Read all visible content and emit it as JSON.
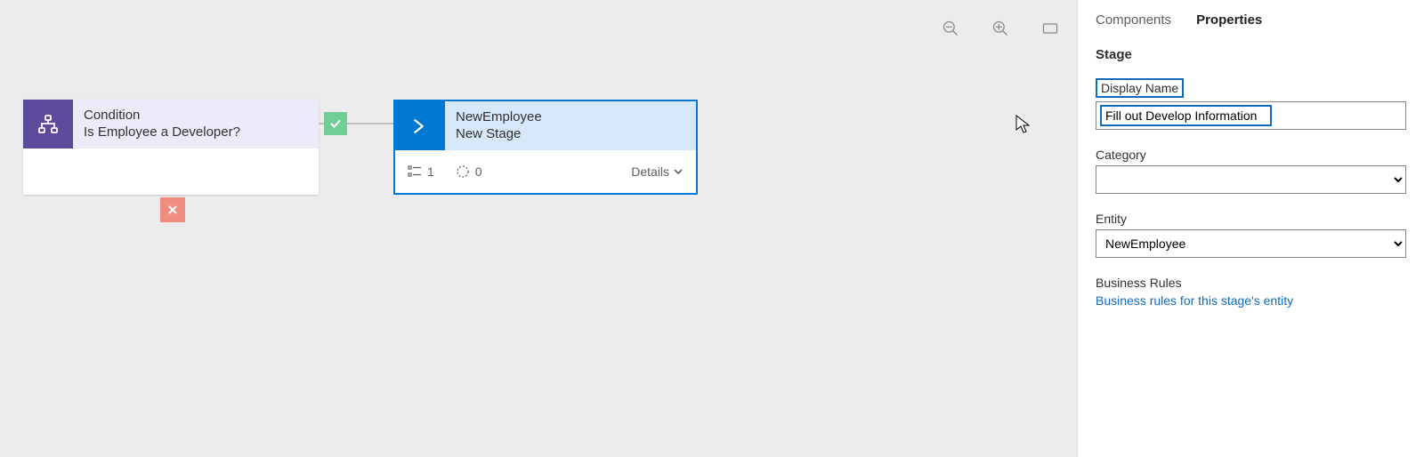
{
  "canvas": {
    "condition": {
      "type_label": "Condition",
      "title": "Is Employee a Developer?"
    },
    "stage": {
      "entity": "NewEmployee",
      "title": "New Stage",
      "steps_count": "1",
      "processes_count": "0",
      "details_label": "Details"
    }
  },
  "panel": {
    "tabs": {
      "components": "Components",
      "properties": "Properties",
      "active": "properties"
    },
    "section": "Stage",
    "display_name": {
      "label": "Display Name",
      "value": "Fill out Develop Information"
    },
    "category": {
      "label": "Category",
      "value": ""
    },
    "entity": {
      "label": "Entity",
      "value": "NewEmployee"
    },
    "business_rules": {
      "label": "Business Rules",
      "link": "Business rules for this stage's entity"
    }
  }
}
